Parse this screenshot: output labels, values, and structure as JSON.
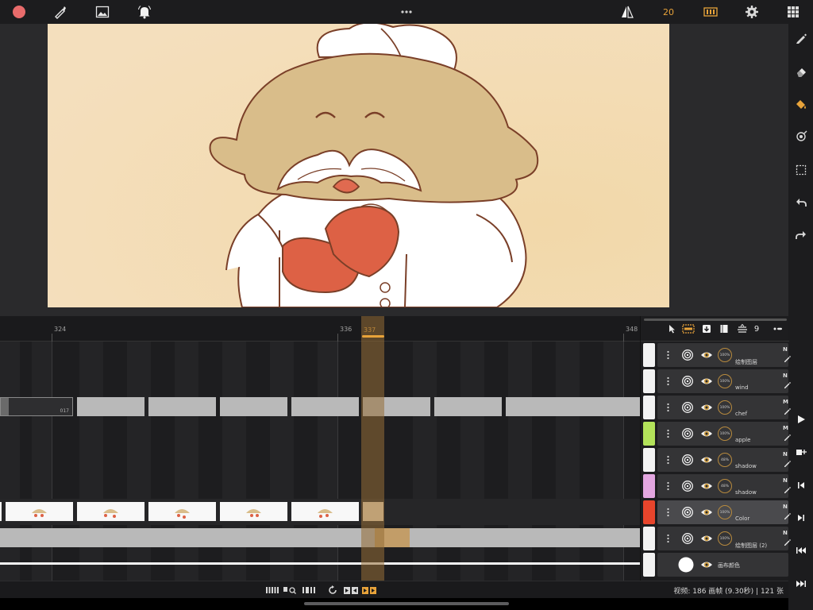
{
  "topbar": {
    "record_color": "#e86b6b",
    "accent_color": "#e8a33a",
    "onion_skin_count": "20",
    "icons": [
      "record-icon",
      "brush-icon",
      "image-icon",
      "bell-icon",
      "more-icon",
      "flip-icon",
      "frames-icon",
      "gear-icon",
      "grid-icon"
    ]
  },
  "timeline": {
    "ruler": [
      {
        "label": "324"
      },
      {
        "label": "336"
      },
      {
        "label": "337",
        "current": true
      },
      {
        "label": "348"
      }
    ],
    "first_cell_label": "017"
  },
  "layers": {
    "header_count": "9",
    "header_icons": [
      "pointer-icon",
      "select-frames-icon",
      "import-icon",
      "book-icon",
      "stack-icon",
      "more-icon"
    ],
    "items": [
      {
        "name": "绘制图层",
        "swatch": "#f2f2f2",
        "mode": "N",
        "opacity": "100%"
      },
      {
        "name": "wind",
        "swatch": "#f2f2f2",
        "mode": "N",
        "opacity": "100%"
      },
      {
        "name": "chef",
        "swatch": "#f2f2f2",
        "mode": "M",
        "opacity": "100%"
      },
      {
        "name": "apple",
        "swatch": "#b3e35a",
        "mode": "M",
        "opacity": "100%"
      },
      {
        "name": "shadow",
        "swatch": "#f2f2f2",
        "mode": "N",
        "opacity": "48%"
      },
      {
        "name": "shadow",
        "swatch": "#e3a6e0",
        "mode": "N",
        "opacity": "48%"
      },
      {
        "name": "Color",
        "swatch": "#e8452c",
        "mode": "N",
        "opacity": "100%",
        "selected": true
      },
      {
        "name": "绘制图层 (2)",
        "swatch": "#f2f2f2",
        "mode": "N",
        "opacity": "100%"
      },
      {
        "name": "画布颜色",
        "swatch": "#f2f2f2",
        "mode": "",
        "opacity": ""
      }
    ]
  },
  "status": {
    "text": "视频: 186 画帧 (9.30秒) | 121 张"
  },
  "right_tools": [
    "pencil-icon",
    "eraser-icon",
    "fill-icon",
    "smudge-icon",
    "selection-icon",
    "undo-icon",
    "redo-icon",
    "play-icon",
    "add-frame-icon",
    "prev-frame-icon",
    "next-frame-icon",
    "first-frame-icon",
    "last-frame-icon"
  ]
}
